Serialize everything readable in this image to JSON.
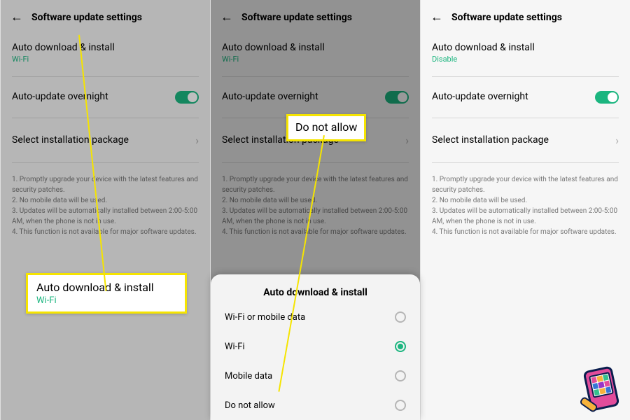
{
  "header": {
    "title": "Software update settings"
  },
  "rows": {
    "auto_download": {
      "title": "Auto download & install"
    },
    "overnight": {
      "title": "Auto-update overnight"
    },
    "select_pkg": {
      "title": "Select installation package"
    }
  },
  "subs": {
    "wifi": "Wi-Fi",
    "disable": "Disable"
  },
  "notes": {
    "n1": "1. Promptly upgrade your device with the latest features and security patches.",
    "n2": "2. No mobile data will be used.",
    "n3": "3. Updates will be automatically installed between 2:00-5:00 AM, when the phone is not in use.",
    "n4": "4. This function is not available for major software updates."
  },
  "sheet": {
    "title": "Auto download & install",
    "options": {
      "o1": "Wi-Fi or mobile data",
      "o2": "Wi-Fi",
      "o3": "Mobile data",
      "o4": "Do not allow"
    }
  },
  "callouts": {
    "c1_title": "Auto download & install",
    "c1_sub": "Wi-Fi",
    "c2": "Do not allow"
  }
}
